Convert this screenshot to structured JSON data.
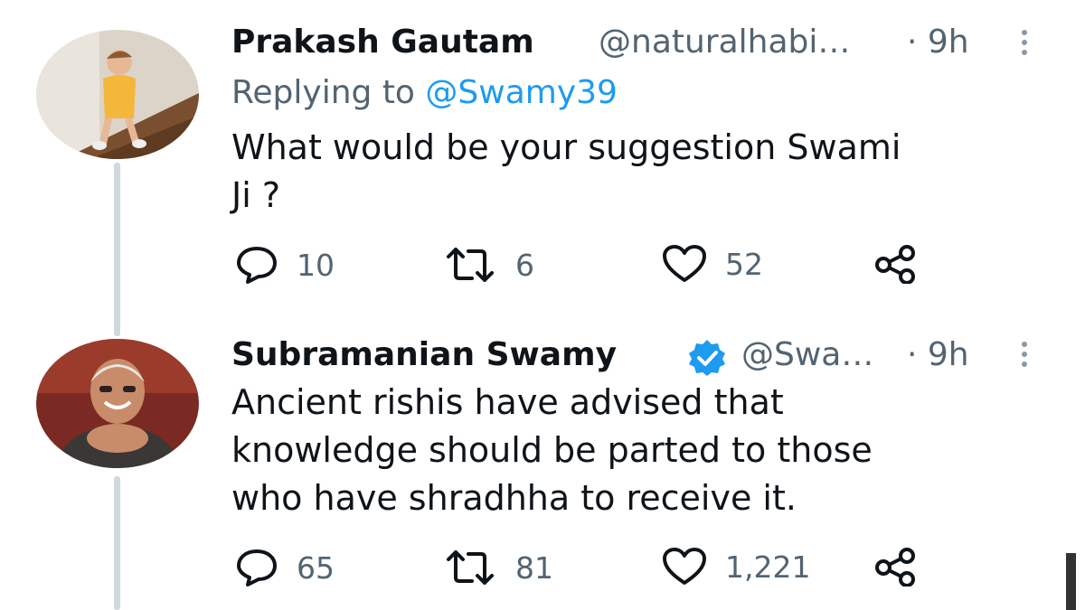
{
  "tweets": [
    {
      "name": "Prakash Gautam",
      "handle": "@naturalhabi…",
      "time": "· 9h",
      "replying_prefix": "Replying to",
      "replying_to": "@Swamy39",
      "text_line1": "What would be your suggestion Swami",
      "text_line2": "Ji ?",
      "replies": "10",
      "retweets": "6",
      "likes": "52"
    },
    {
      "name": "Subramanian Swamy",
      "handle": "@Swa…",
      "time": "· 9h",
      "verified": true,
      "text_line1": "Ancient rishis have advised that",
      "text_line2": "knowledge should be parted to those",
      "text_line3": "who have shradhha to receive it.",
      "replies": "65",
      "retweets": "81",
      "likes": "1,221"
    }
  ],
  "colors": {
    "accent": "#1d9bf0",
    "secondary_text": "#536471",
    "thread_line": "#cfd9de"
  },
  "icons": [
    "more-icon",
    "reply-icon",
    "retweet-icon",
    "like-icon",
    "share-icon",
    "verified-badge-icon"
  ]
}
